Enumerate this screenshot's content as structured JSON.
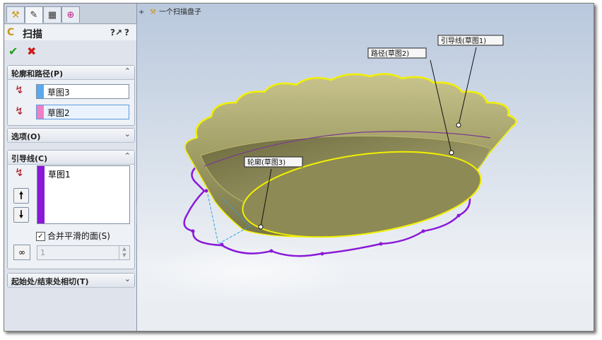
{
  "property_manager": {
    "tabs": [
      {
        "icon": "feature-manager-icon"
      },
      {
        "icon": "property-manager-icon",
        "active": true
      },
      {
        "icon": "configuration-manager-icon"
      },
      {
        "icon": "dimxpert-icon"
      }
    ],
    "title": "扫描",
    "help_label": "?",
    "ok_icon": "✔",
    "cancel_icon": "✖",
    "profile_path": {
      "header": "轮廓和路径(P)",
      "profile_value": "草图3",
      "profile_color": "#5aa9ec",
      "path_value": "草图2",
      "path_color": "#f07fc4"
    },
    "options": {
      "header": "选项(O)"
    },
    "guide_curves": {
      "header": "引导线(C)",
      "items": [
        "草图1"
      ],
      "color": "#8a18d8",
      "merge_smooth_label": "合并平滑的面(S)",
      "merge_smooth_checked": true,
      "spin_value": "1"
    },
    "tangency": {
      "header": "起始处/结束处相切(T)"
    }
  },
  "viewport": {
    "tree_root_label": "一个扫描盘子",
    "callouts": {
      "guide": "引导线(草图1)",
      "path": "路径(草图2)",
      "profile": "轮廓(草图3)"
    },
    "colors": {
      "body": "#9f9c64",
      "edge_highlight": "#f2f000",
      "guide_curve": "#8a18d8"
    }
  }
}
